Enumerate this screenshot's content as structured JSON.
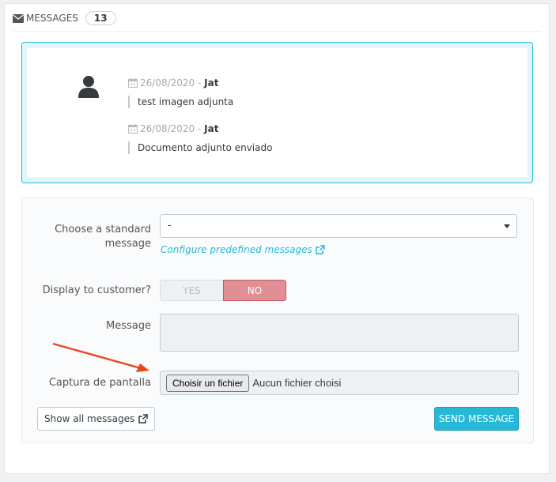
{
  "panel": {
    "title": "MESSAGES",
    "count": "13"
  },
  "messages": [
    {
      "date": "26/08/2020",
      "separator": " - ",
      "author": "Jat",
      "text": "test imagen adjunta"
    },
    {
      "date": "26/08/2020",
      "separator": " - ",
      "author": "Jat",
      "text": "Documento adjunto enviado"
    }
  ],
  "form": {
    "standard_message_label": "Choose a standard message",
    "standard_message_value": "-",
    "configure_link": "Configure predefined messages",
    "display_label": "Display to customer?",
    "toggle_yes": "YES",
    "toggle_no": "NO",
    "toggle_selected": "NO",
    "message_label": "Message",
    "message_value": "",
    "capture_label": "Captura de pantalla",
    "file_button": "Choisir un fichier",
    "file_status": "Aucun fichier choisi",
    "show_all": "Show all messages",
    "send": "SEND MESSAGE"
  },
  "colors": {
    "accent": "#25b9d7",
    "toggle_no": "#e08f95",
    "annotation_arrow": "#e8461c"
  },
  "icons": [
    "envelope-icon",
    "user-icon",
    "calendar-icon",
    "external-link-icon",
    "annotation-arrow"
  ]
}
